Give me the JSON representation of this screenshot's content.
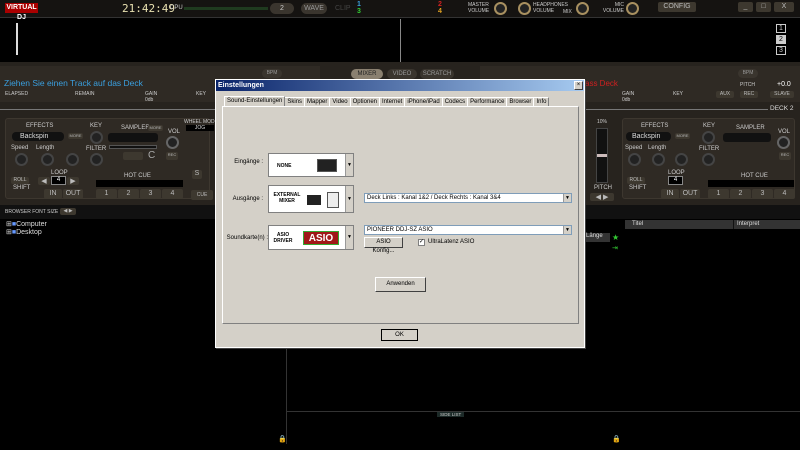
{
  "topbar": {
    "logo": "VIRTUAL DJ",
    "clock": "21:42:49",
    "cpu_label": "CPU",
    "deck_count": "2",
    "wave_label": "WAVE",
    "clip_label": "CLIP",
    "deck_nums_left": [
      "1",
      "3"
    ],
    "deck_nums_right": [
      "2",
      "4"
    ],
    "master_volume": "MASTER VOLUME",
    "headphones_volume": "HEADPHONES VOLUME",
    "mix": "MIX",
    "mic_volume": "MIC VOLUME",
    "config": "CONFIG",
    "minimize": "_",
    "maximize": "□",
    "close": "X"
  },
  "waveform": {
    "deck_buttons": [
      "1",
      "2",
      "3"
    ]
  },
  "left_deck": {
    "track_prompt": "Ziehen Sie einen Track auf das Deck",
    "elapsed": "ELAPSED",
    "remain": "REMAIN",
    "gain": "GAIN",
    "gain_value": "0db",
    "key": "KEY",
    "bpm": "BPM",
    "effects": "EFFECTS",
    "effect_value": "Backspin",
    "more": "MORE",
    "speed": "Speed",
    "length": "Length",
    "key_label": "KEY",
    "filter": "FILTER",
    "sampler": "SAMPLER",
    "vol": "VOL",
    "rec": "REC",
    "loop": "LOOP",
    "loop_value": "4",
    "roll": "ROLL",
    "shift": "SHIFT",
    "in": "IN",
    "out": "OUT",
    "hot_cue": "HOT CUE",
    "hot_cues": [
      "1",
      "2",
      "3",
      "4"
    ],
    "wheel_mode": "WHEEL MODE",
    "wheel_value": "JOG",
    "s": "S",
    "cue": "CUE"
  },
  "mixer_tabs": [
    "MIXER",
    "VIDEO",
    "SCRATCH"
  ],
  "right_deck": {
    "track_prompt": "ass Deck",
    "gain": "GAIN",
    "gain_value": "0db",
    "key": "KEY",
    "bpm": "BPM",
    "pitch": "PITCH",
    "pitch_value": "+0.0",
    "aux": "AUX",
    "rec": "REC",
    "slave": "SLAVE",
    "deck_label": "DECK 2",
    "pitch_range": "10%",
    "pitch_label": "PITCH",
    "effects": "EFFECTS",
    "effect_value": "Backspin",
    "more": "MORE",
    "speed": "Speed",
    "length": "Length",
    "key_label": "KEY",
    "filter": "FILTER",
    "sampler": "SAMPLER",
    "vol": "VOL",
    "loop": "LOOP",
    "loop_value": "4",
    "roll": "ROLL",
    "shift": "SHIFT",
    "in": "IN",
    "out": "OUT",
    "hot_cue": "HOT CUE",
    "hot_cues": [
      "1",
      "2",
      "3",
      "4"
    ]
  },
  "browser": {
    "font_size_label": "BROWSER FONT SIZE",
    "tree": [
      "Computer",
      "Desktop"
    ],
    "columns": [
      "Titel",
      "Interpret"
    ],
    "partial_column": "Länge",
    "side_list": "SIDE LIST"
  },
  "dialog": {
    "title": "Einstellungen",
    "close": "×",
    "tabs": [
      "Sound-Einstellungen",
      "Skins",
      "Mapper",
      "Video",
      "Optionen",
      "Internet",
      "iPhone/iPad",
      "Codecs",
      "Performance",
      "Browser",
      "Info"
    ],
    "inputs_label": "Eingänge :",
    "inputs_value": "NONE",
    "outputs_label": "Ausgänge :",
    "outputs_value": "EXTERNAL MIXER",
    "outputs_channels": "Deck Links : Kanal 1&2 / Deck Rechts : Kanal 3&4",
    "soundcard_label": "Soundkarte(n) :",
    "soundcard_value": "ASIO DRIVER",
    "asio_logo": "ASIO",
    "soundcard_device": "PIONEER DDJ-SZ ASIO",
    "asio_config": "ASIO Konfig...",
    "ultra_latency": "UltraLatenz ASIO",
    "ultra_latency_checked": true,
    "apply": "Anwenden",
    "ok": "OK"
  },
  "colors": {
    "accent_blue": "#3aa0e0",
    "accent_red": "#d02020",
    "deck_bg": "#27231e",
    "dialog_bg": "#d4d0c8"
  }
}
